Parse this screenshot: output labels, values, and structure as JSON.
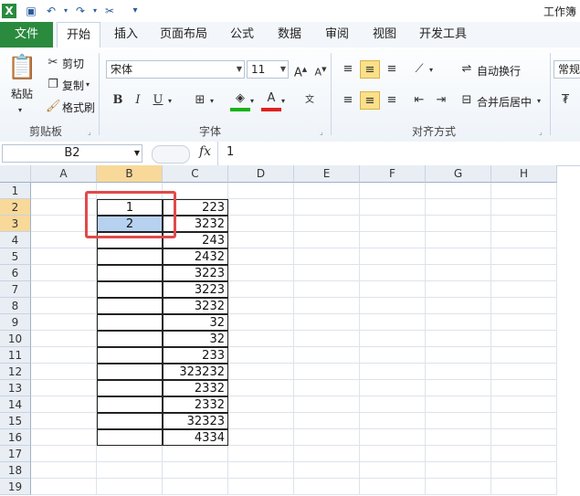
{
  "title": "工作簿",
  "tabs": {
    "file": "文件",
    "items": [
      "开始",
      "插入",
      "页面布局",
      "公式",
      "数据",
      "审阅",
      "视图",
      "开发工具"
    ]
  },
  "ribbon": {
    "clipboard": {
      "paste": "粘贴",
      "cut": "剪切",
      "copy": "复制",
      "format_painter": "格式刷",
      "group": "剪贴板"
    },
    "font": {
      "name": "宋体",
      "size": "11",
      "bold": "B",
      "italic": "I",
      "underline": "U",
      "group": "字体"
    },
    "align": {
      "wrap": "自动换行",
      "merge": "合并后居中",
      "group": "对齐方式"
    },
    "number": {
      "format": "常规"
    }
  },
  "formula_bar": {
    "name_box": "B2",
    "fx": "fx",
    "value": "1"
  },
  "columns": [
    "A",
    "B",
    "C",
    "D",
    "E",
    "F",
    "G",
    "H"
  ],
  "rows": [
    "1",
    "2",
    "3",
    "4",
    "5",
    "6",
    "7",
    "8",
    "9",
    "10",
    "11",
    "12",
    "13",
    "14",
    "15",
    "16",
    "17",
    "18",
    "19"
  ],
  "cells": {
    "B2": "1",
    "B3": "2",
    "C2": "223",
    "C3": "3232",
    "C4": "243",
    "C5": "2432",
    "C6": "3223",
    "C7": "3223",
    "C8": "3232",
    "C9": "32",
    "C10": "32",
    "C11": "233",
    "C12": "323232",
    "C13": "2332",
    "C14": "2332",
    "C15": "32323",
    "C16": "4334"
  },
  "selected_range": "B2:B3",
  "colors": {
    "file_tab": "#2a8a3e",
    "highlight": "#e04a4a",
    "selection": "#b7d2f0"
  }
}
